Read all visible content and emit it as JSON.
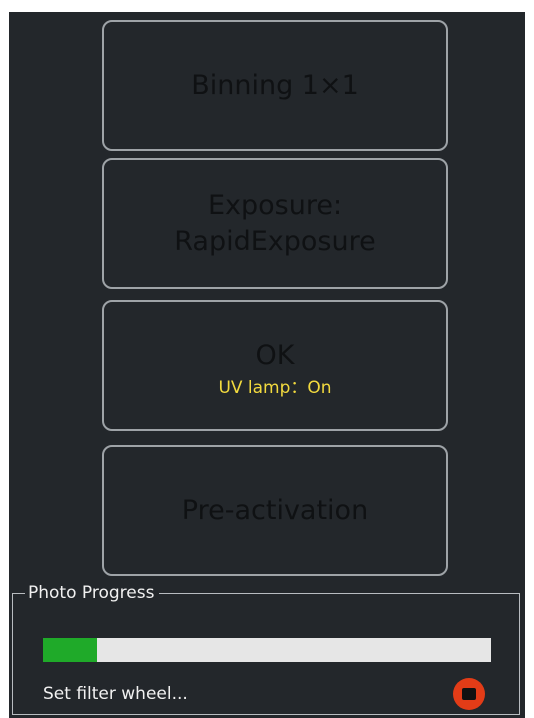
{
  "buttons": {
    "binning_label": "Binning 1×1",
    "exposure_label_line1": "Exposure:",
    "exposure_label_line2": "RapidExposure",
    "ok_label": "OK",
    "uv_lamp_status": "UV lamp：On",
    "preactivation_label": "Pre-activation"
  },
  "progress": {
    "title": "Photo Progress",
    "value": 0.12,
    "status_text": "Set filter wheel...",
    "stop_icon": "stop-icon"
  },
  "colors": {
    "panel_background": "#23272b",
    "button_border": "#9ea3a7",
    "status_yellow": "#f2da3e",
    "progress_green": "#1faa29",
    "stop_red": "#e33c17"
  }
}
